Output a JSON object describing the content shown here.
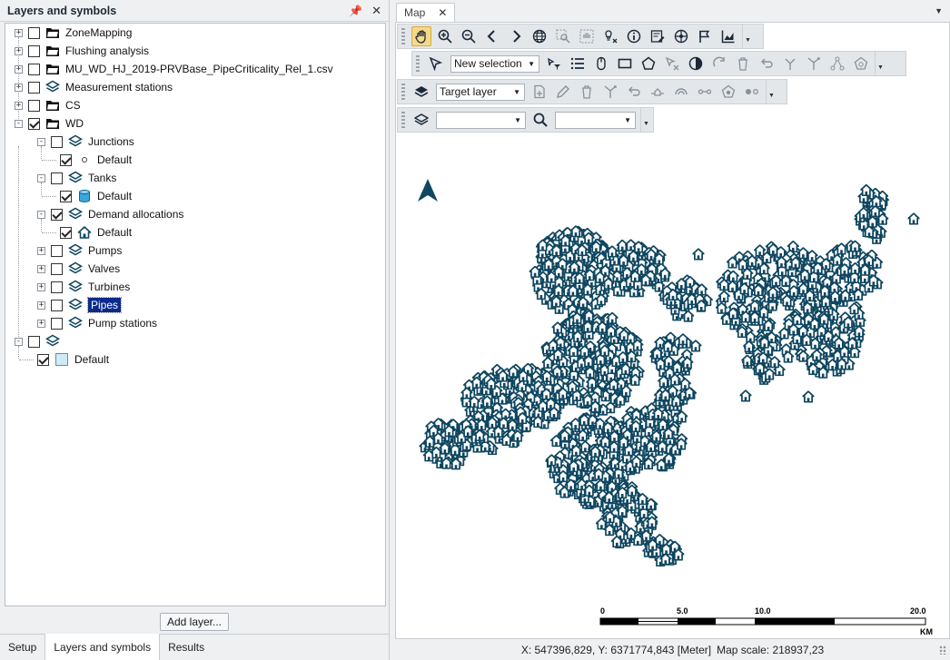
{
  "left_panel": {
    "title": "Layers and symbols",
    "tree": [
      {
        "label": "ZoneMapping",
        "icon": "folder-icon",
        "checked": false,
        "expander": "+"
      },
      {
        "label": "Flushing analysis",
        "icon": "folder-icon",
        "checked": false,
        "expander": "+"
      },
      {
        "label": "MU_WD_HJ_2019-PRVBase_PipeCriticality_Rel_1.csv",
        "icon": "folder-icon",
        "checked": false,
        "expander": "+"
      },
      {
        "label": "Measurement stations",
        "icon": "layers-icon",
        "checked": false,
        "expander": "+"
      },
      {
        "label": "CS",
        "icon": "folder-icon",
        "checked": false,
        "expander": "+"
      },
      {
        "label": "WD",
        "icon": "folder-icon",
        "checked": true,
        "expander": "-"
      },
      {
        "label": "Junctions",
        "icon": "layers-icon",
        "checked": false,
        "expander": "-"
      },
      {
        "label": "Default",
        "icon": "small-circle-icon",
        "checked": true
      },
      {
        "label": "Tanks",
        "icon": "layers-icon",
        "checked": false,
        "expander": "-"
      },
      {
        "label": "Default",
        "icon": "tank-cylinder-icon",
        "checked": true
      },
      {
        "label": "Demand allocations",
        "icon": "layers-icon",
        "checked": true,
        "expander": "-"
      },
      {
        "label": "Default",
        "icon": "house-icon",
        "checked": true
      },
      {
        "label": "Pumps",
        "icon": "layers-icon",
        "checked": false,
        "expander": "+"
      },
      {
        "label": "Valves",
        "icon": "layers-icon",
        "checked": false,
        "expander": "+"
      },
      {
        "label": "Turbines",
        "icon": "layers-icon",
        "checked": false,
        "expander": "+"
      },
      {
        "label": "Pipes",
        "icon": "layers-icon",
        "checked": false,
        "expander": "+",
        "selected": true
      },
      {
        "label": "Pump stations",
        "icon": "layers-icon",
        "checked": false,
        "expander": "+"
      },
      {
        "label": "",
        "icon": "layers-icon",
        "checked": false,
        "expander": "-"
      },
      {
        "label": "Default",
        "icon": "light-square-icon",
        "checked": true
      }
    ],
    "add_layer_label": "Add layer...",
    "bottom_tabs": [
      "Setup",
      "Layers and symbols",
      "Results"
    ],
    "active_bottom_tab": "Layers and symbols"
  },
  "map_panel": {
    "tab_label": "Map",
    "toolbar1_icons": [
      "pan-hand-icon",
      "zoom-in-icon",
      "zoom-out-icon",
      "back-arrow-icon",
      "forward-arrow-icon",
      "globe-icon",
      "zoom-to-selection-icon",
      "pan-selection-icon",
      "clear-highlight-icon",
      "info-icon",
      "edit-table-icon",
      "network-icon",
      "flag-icon",
      "chart-icon"
    ],
    "toolbar2": {
      "selection_mode": "New selection",
      "icons": [
        "select-pointer-icon",
        "select-by-filter-icon",
        "list-icon",
        "mouse-icon",
        "rectangle-select-icon",
        "polygon-select-icon",
        "clear-selection-icon",
        "invert-selection-icon",
        "refresh-icon",
        "delete-icon",
        "undo-icon",
        "split-icon",
        "branch-icon",
        "connect-icon",
        "node-icon"
      ]
    },
    "toolbar3": {
      "target_layer": "Target layer",
      "icons": [
        "target-layers-icon",
        "new-feature-icon",
        "pencil-icon",
        "trash-icon",
        "split-pipe-icon",
        "undo-icon",
        "pipe-node-icon",
        "arc-icon",
        "link-icon",
        "pump-node-icon",
        "dots-icon"
      ]
    },
    "toolbar4": {
      "layer_value": "",
      "search_value": "",
      "icons": [
        "layers-icon",
        "search-icon"
      ]
    },
    "scale_bar": {
      "ticks": [
        "0",
        "5.0",
        "10.0",
        "20.0"
      ],
      "unit": "KM"
    },
    "status": {
      "coords": "X: 547396,829, Y: 6371774,843 [Meter]",
      "scale": "Map scale: 218937,23"
    },
    "colors": {
      "features": "#0f4660",
      "highlight": "#f5d98a",
      "selection": "#0b2a8a"
    }
  }
}
